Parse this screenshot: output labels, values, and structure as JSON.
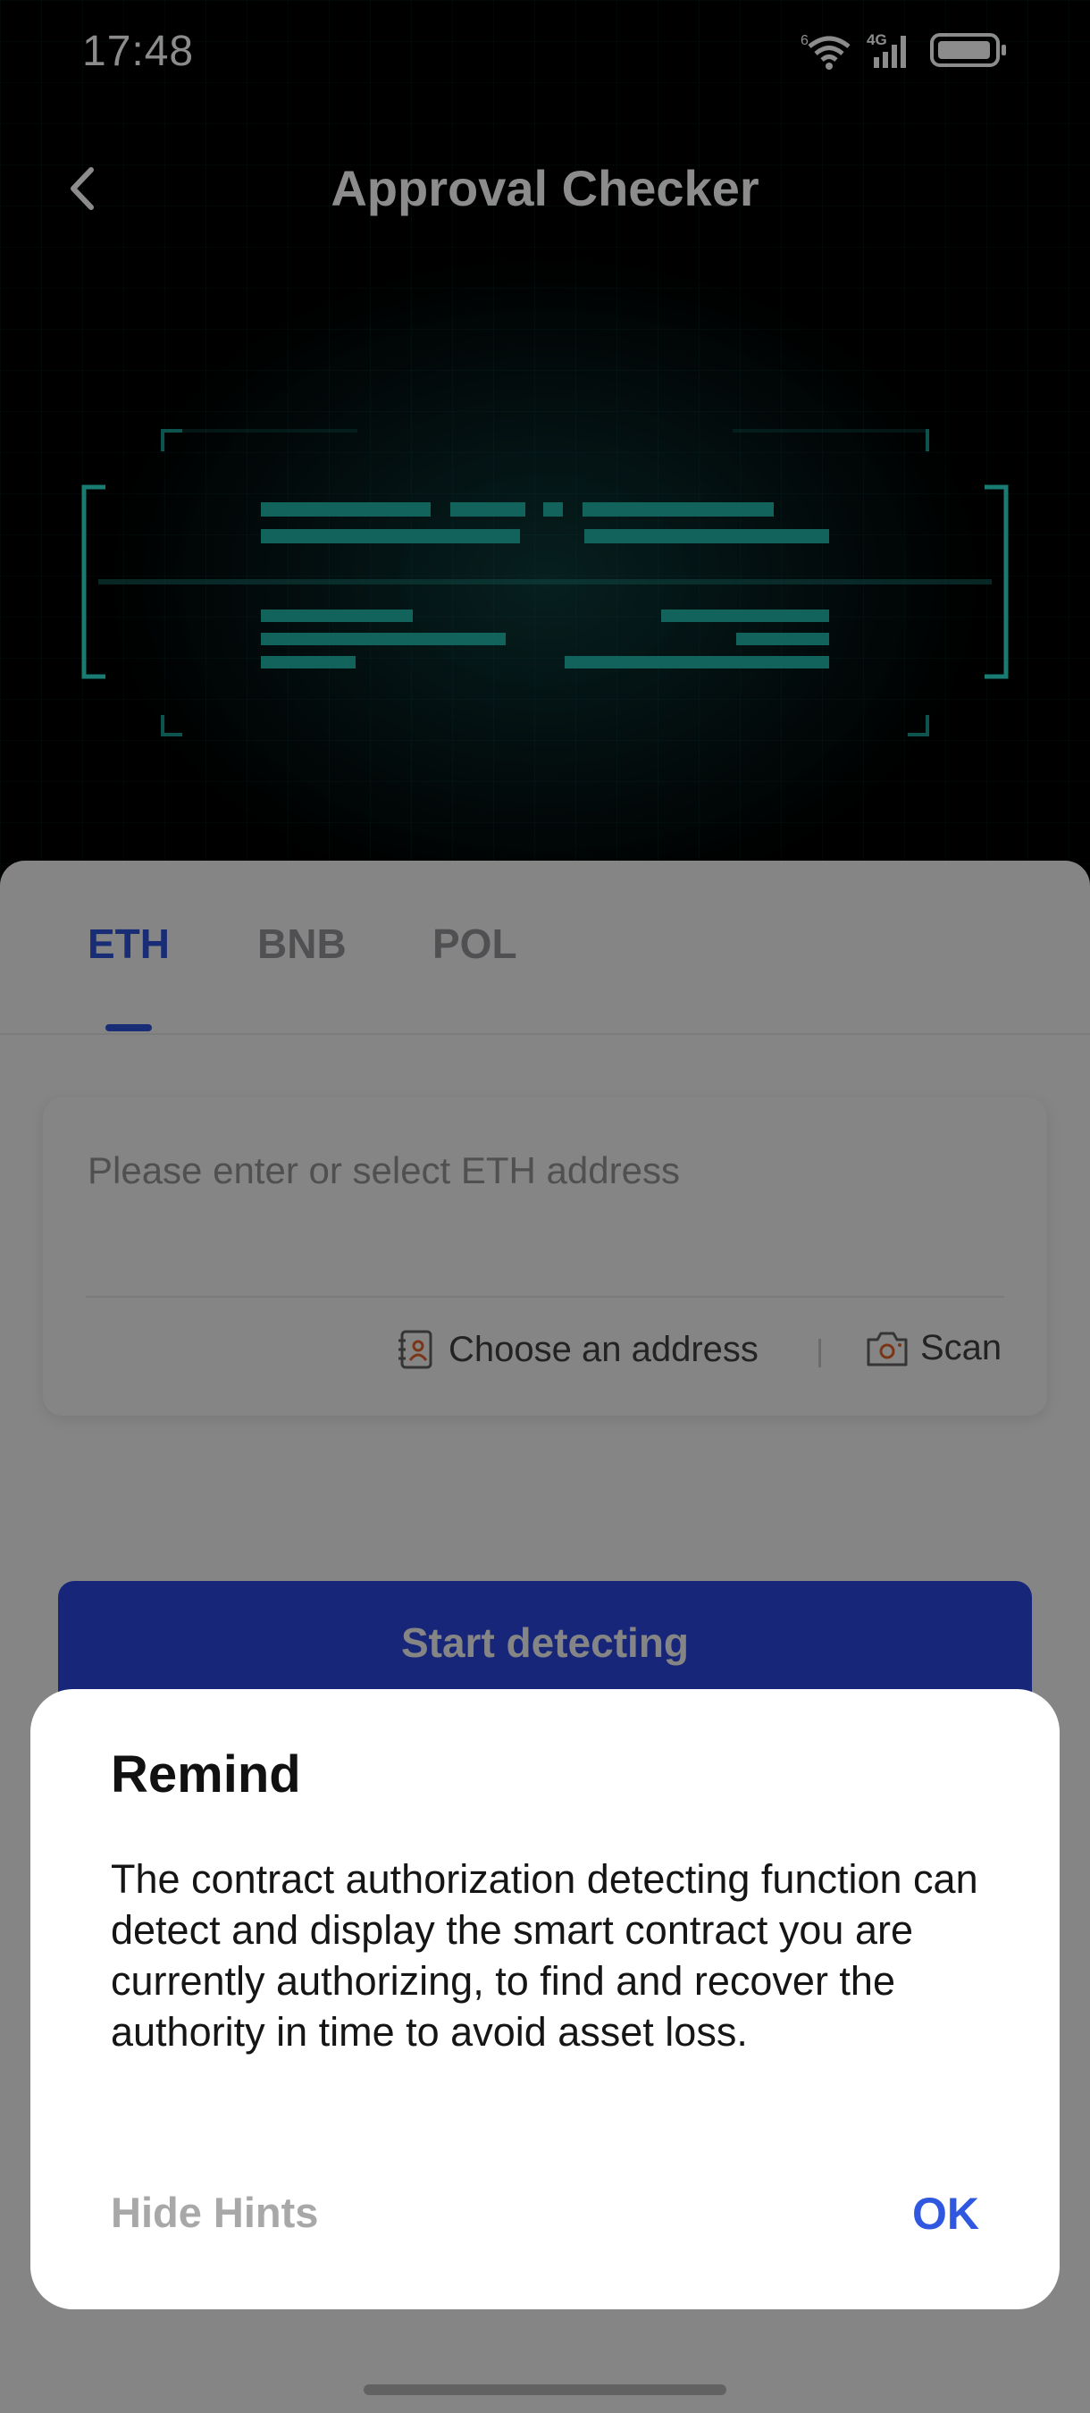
{
  "status_bar": {
    "time": "17:48",
    "network": "4G",
    "wifi_badge": "6"
  },
  "header": {
    "title": "Approval Checker"
  },
  "tabs": [
    {
      "label": "ETH",
      "active": true
    },
    {
      "label": "BNB",
      "active": false
    },
    {
      "label": "POL",
      "active": false
    }
  ],
  "address_card": {
    "placeholder": "Please enter or select ETH address",
    "value": "",
    "choose_label": "Choose an address",
    "scan_label": "Scan"
  },
  "start_button": {
    "label": "Start detecting"
  },
  "dialog": {
    "title": "Remind",
    "body": "The contract authorization detecting function can detect and display the smart contract you are currently authorizing, to find and recover the authority in time to avoid asset loss.",
    "secondary_label": "Hide Hints",
    "primary_label": "OK"
  },
  "colors": {
    "accent": "#2f57e0",
    "teal": "#1fb5a8",
    "button": "#2c49e6"
  }
}
